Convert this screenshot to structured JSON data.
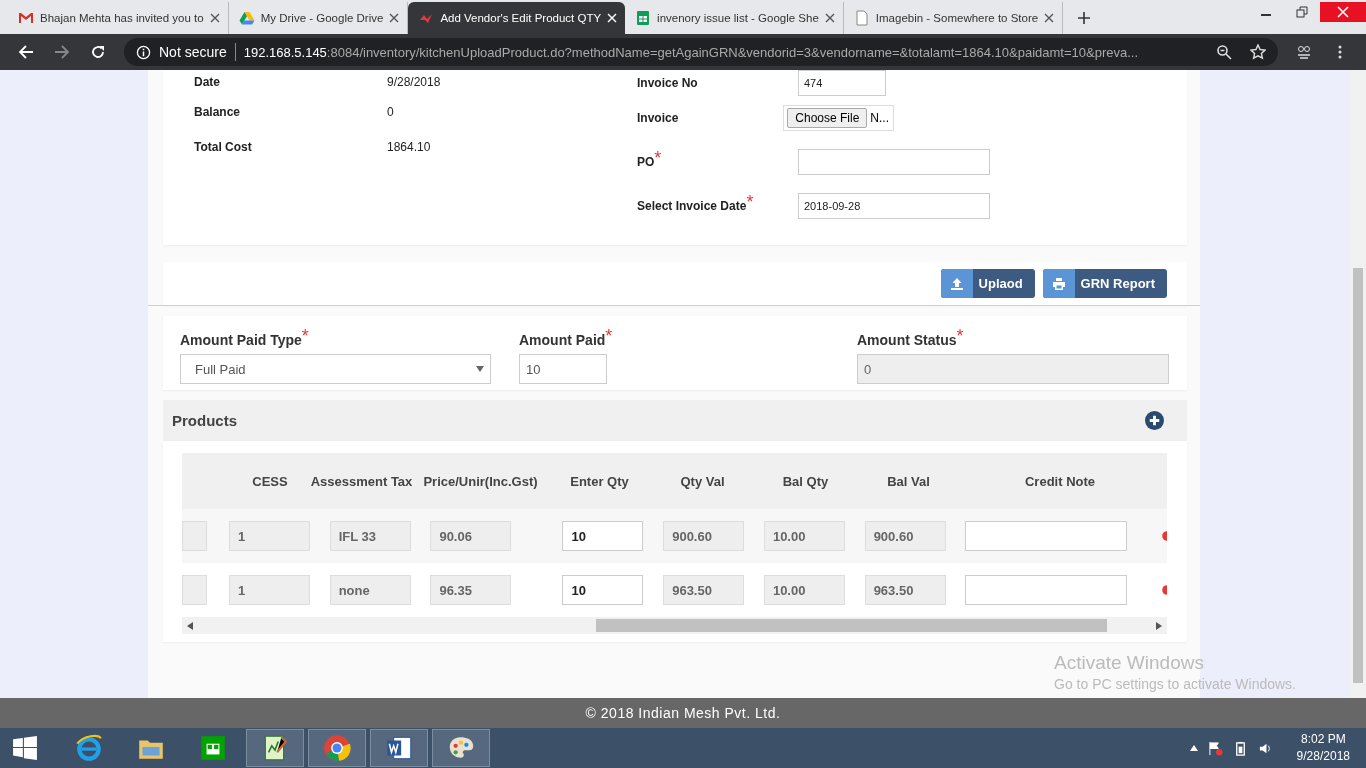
{
  "browser": {
    "tabs": [
      {
        "title": "Bhajan Mehta has invited you to",
        "selected": false
      },
      {
        "title": "My Drive - Google Drive",
        "selected": false
      },
      {
        "title": "Add Vendor's Edit Product QTY",
        "selected": true
      },
      {
        "title": "invenory issue list - Google She",
        "selected": false
      },
      {
        "title": "Imagebin - Somewhere to Store",
        "selected": false
      }
    ],
    "security": "Not secure",
    "host": "192.168.5.145",
    "path": ":8084/inventory/kitchenUploadProduct.do?methodName=getAgainGRN&vendorid=3&vendorname=&totalamt=1864.10&paidamt=10&preva..."
  },
  "summary": [
    {
      "label": "Date",
      "value": "9/28/2018"
    },
    {
      "label": "Balance",
      "value": "0"
    },
    {
      "label": "Total Cost",
      "value": "1864.10"
    }
  ],
  "invoice_fields": [
    {
      "label": "Invoice No",
      "kind": "text",
      "value": "474"
    },
    {
      "label": "Invoice",
      "kind": "file",
      "button": "Choose File",
      "status": "N..."
    },
    {
      "label": "PO",
      "mark": "*",
      "kind": "text"
    },
    {
      "label": "Select Invoice Date",
      "mark": "*",
      "kind": "date",
      "value": "2018-09-28"
    }
  ],
  "actions": [
    {
      "label": "Uplaod"
    },
    {
      "label": "GRN Report"
    }
  ],
  "payment": [
    {
      "label": "Amount Paid Type",
      "mark": "*",
      "kind": "select",
      "value": "Full Paid"
    },
    {
      "label": "Amount Paid",
      "mark": "*",
      "kind": "input",
      "value": "10"
    },
    {
      "label": "Amount Status",
      "mark": "*",
      "kind": "readonly",
      "value": "0"
    }
  ],
  "products": {
    "title": "Products",
    "columns": [
      "CESS",
      "Assessment Tax",
      "Price/Unir(Inc.Gst)",
      "Enter Qty",
      "Qty Val",
      "Bal Qty",
      "Bal Val",
      "Credit Note"
    ],
    "rows": [
      {
        "cells": [
          {
            "value": "1",
            "editable": false
          },
          {
            "value": "IFL 33",
            "editable": false
          },
          {
            "value": "90.06",
            "editable": false
          },
          {
            "value": "10",
            "editable": true
          },
          {
            "value": "900.60",
            "editable": false
          },
          {
            "value": "10.00",
            "editable": false
          },
          {
            "value": "900.60",
            "editable": false
          },
          {
            "editable": true
          }
        ]
      },
      {
        "cells": [
          {
            "value": "1",
            "editable": false
          },
          {
            "value": "none",
            "editable": false
          },
          {
            "value": "96.35",
            "editable": false
          },
          {
            "value": "10",
            "editable": true
          },
          {
            "value": "963.50",
            "editable": false
          },
          {
            "value": "10.00",
            "editable": false
          },
          {
            "value": "963.50",
            "editable": false
          },
          {
            "editable": true
          }
        ]
      }
    ]
  },
  "footer": "© 2018 Indian Mesh Pvt. Ltd.",
  "activation": {
    "title": "Activate Windows",
    "subtitle": "Go to PC settings to activate Windows."
  },
  "taskbar": {
    "apps": [
      {
        "selected": false
      },
      {
        "selected": false
      },
      {
        "selected": false
      },
      {
        "selected": true
      },
      {
        "selected": true
      },
      {
        "selected": true
      },
      {
        "selected": true
      }
    ],
    "time": "8:02 PM",
    "date": "9/28/2018"
  }
}
